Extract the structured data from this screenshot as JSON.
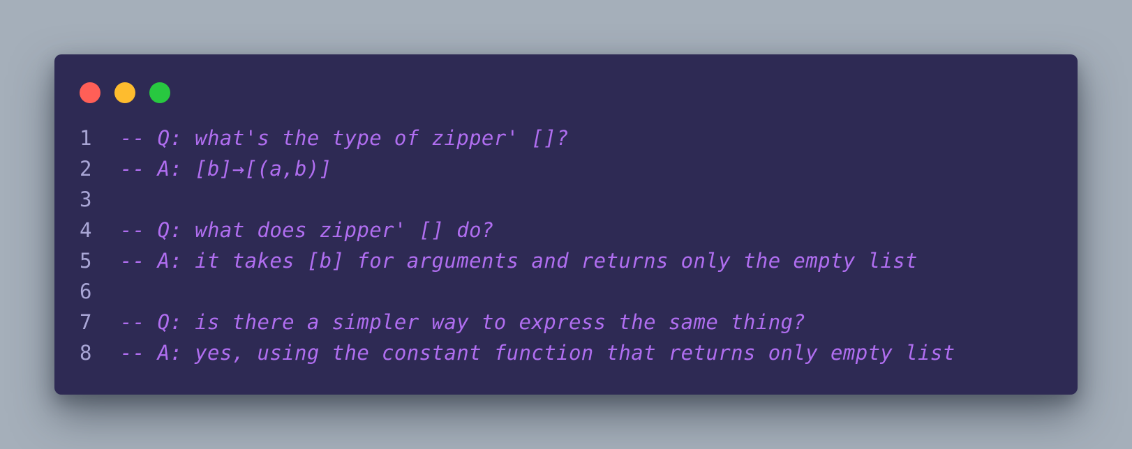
{
  "window": {
    "controls": [
      {
        "name": "close",
        "color": "#ff5f57"
      },
      {
        "name": "minimize",
        "color": "#febc2e"
      },
      {
        "name": "maximize",
        "color": "#28c840"
      }
    ]
  },
  "colors": {
    "background": "#a5afba",
    "editor": "#2e2a54",
    "line_number": "#a9a6d6",
    "comment": "#b06ef0"
  },
  "code": {
    "lines": [
      {
        "number": "1",
        "text": "-- Q: what's the type of zipper' []?"
      },
      {
        "number": "2",
        "text": "-- A: [b]→[(a,b)]"
      },
      {
        "number": "3",
        "text": ""
      },
      {
        "number": "4",
        "text": "-- Q: what does zipper' [] do?"
      },
      {
        "number": "5",
        "text": "-- A: it takes [b] for arguments and returns only the empty list"
      },
      {
        "number": "6",
        "text": ""
      },
      {
        "number": "7",
        "text": "-- Q: is there a simpler way to express the same thing?"
      },
      {
        "number": "8",
        "text": "-- A: yes, using the constant function that returns only empty list"
      }
    ]
  }
}
